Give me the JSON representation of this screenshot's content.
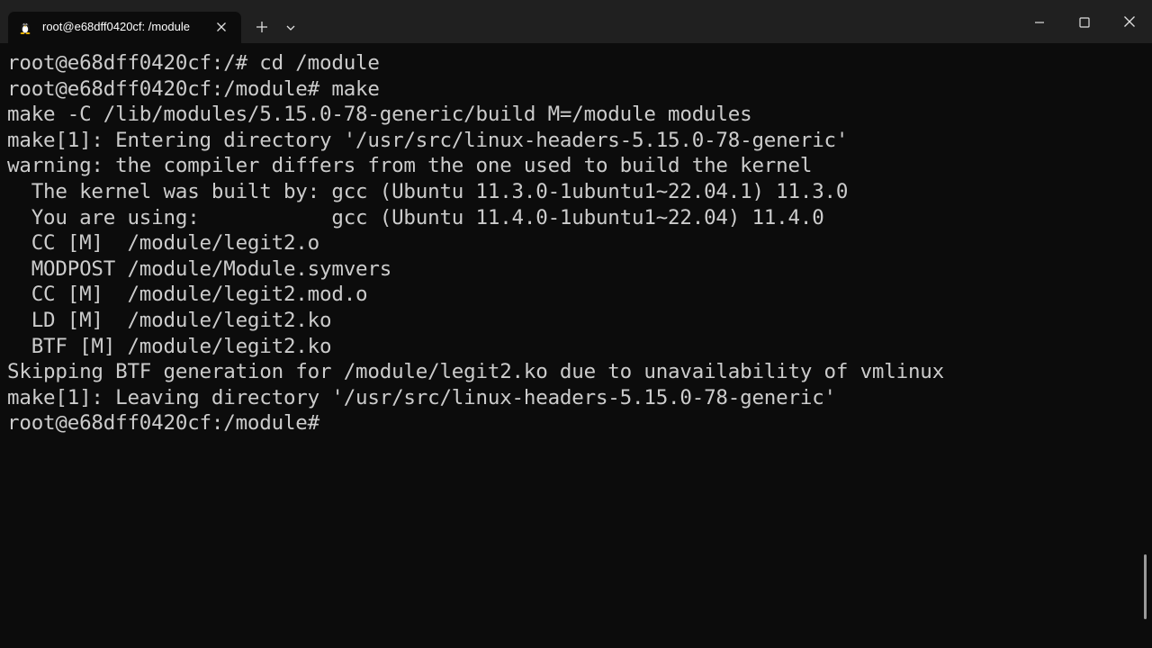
{
  "window": {
    "tab_title": "root@e68dff0420cf: /module",
    "icons": {
      "tab": "linux-penguin-icon",
      "close_tab": "close-icon",
      "new_tab": "plus-icon",
      "dropdown": "chevron-down-icon",
      "minimize": "minimize-icon",
      "maximize": "maximize-icon",
      "close_window": "close-icon"
    }
  },
  "terminal": {
    "lines": [
      "root@e68dff0420cf:/# cd /module",
      "root@e68dff0420cf:/module# make",
      "make -C /lib/modules/5.15.0-78-generic/build M=/module modules",
      "make[1]: Entering directory '/usr/src/linux-headers-5.15.0-78-generic'",
      "warning: the compiler differs from the one used to build the kernel",
      "  The kernel was built by: gcc (Ubuntu 11.3.0-1ubuntu1~22.04.1) 11.3.0",
      "  You are using:           gcc (Ubuntu 11.4.0-1ubuntu1~22.04) 11.4.0",
      "  CC [M]  /module/legit2.o",
      "  MODPOST /module/Module.symvers",
      "  CC [M]  /module/legit2.mod.o",
      "  LD [M]  /module/legit2.ko",
      "  BTF [M] /module/legit2.ko",
      "Skipping BTF generation for /module/legit2.ko due to unavailability of vmlinux",
      "make[1]: Leaving directory '/usr/src/linux-headers-5.15.0-78-generic'",
      "root@e68dff0420cf:/module#"
    ],
    "colors": {
      "background": "#0c0c0c",
      "foreground": "#cccccc",
      "titlebar": "#202020"
    },
    "scroll_position": 0.95
  }
}
